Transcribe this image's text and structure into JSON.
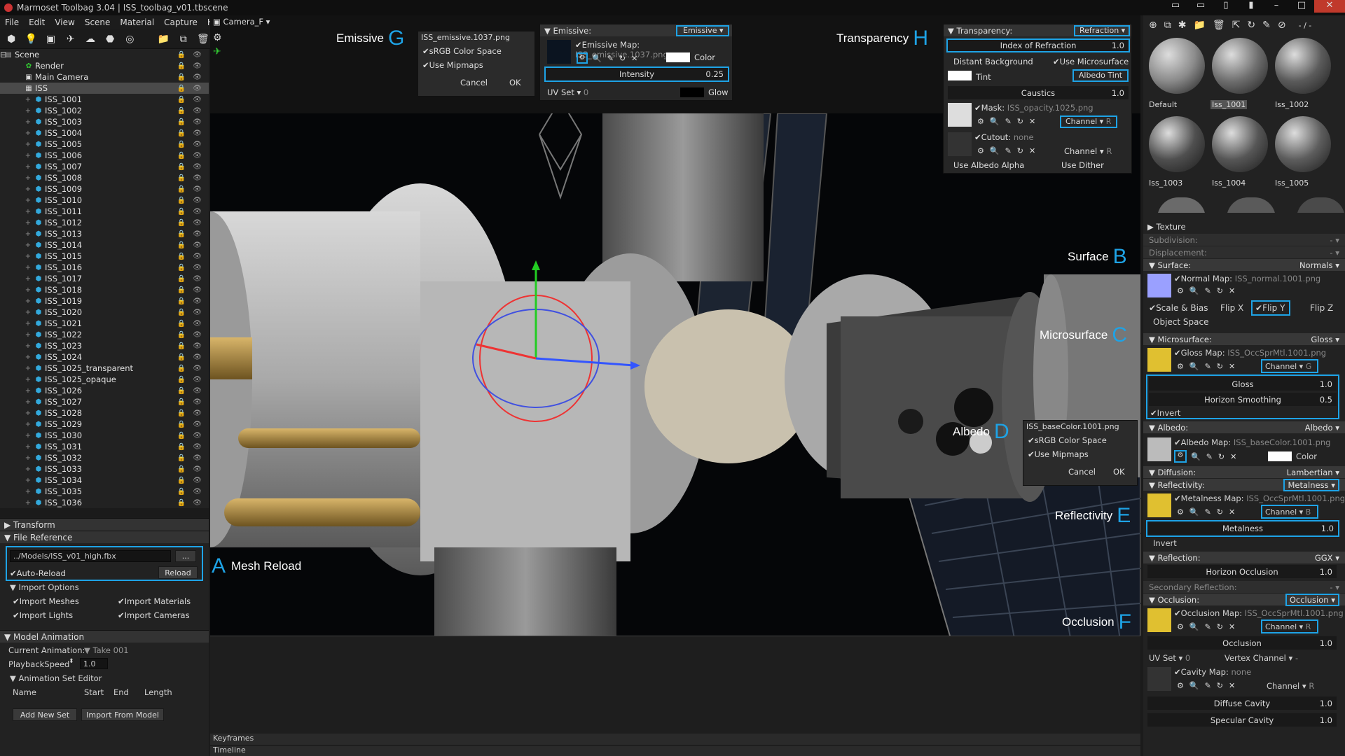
{
  "window": {
    "title": "Marmoset Toolbag 3.04  |  ISS_toolbag_v01.tbscene"
  },
  "menu": [
    "File",
    "Edit",
    "View",
    "Scene",
    "Material",
    "Capture",
    "Help"
  ],
  "viewport": {
    "camera": "Camera_F"
  },
  "outliner": {
    "items": [
      {
        "label": "Scene",
        "level": 0,
        "kind": "scene"
      },
      {
        "label": "Render",
        "level": 1,
        "kind": "render"
      },
      {
        "label": "Main Camera",
        "level": 1,
        "kind": "camera"
      },
      {
        "label": "ISS",
        "level": 1,
        "kind": "group",
        "selected": true
      },
      {
        "label": "ISS_1001",
        "level": 2,
        "kind": "mesh"
      },
      {
        "label": "ISS_1002",
        "level": 2,
        "kind": "mesh"
      },
      {
        "label": "ISS_1003",
        "level": 2,
        "kind": "mesh"
      },
      {
        "label": "ISS_1004",
        "level": 2,
        "kind": "mesh"
      },
      {
        "label": "ISS_1005",
        "level": 2,
        "kind": "mesh"
      },
      {
        "label": "ISS_1006",
        "level": 2,
        "kind": "mesh"
      },
      {
        "label": "ISS_1007",
        "level": 2,
        "kind": "mesh"
      },
      {
        "label": "ISS_1008",
        "level": 2,
        "kind": "mesh"
      },
      {
        "label": "ISS_1009",
        "level": 2,
        "kind": "mesh"
      },
      {
        "label": "ISS_1010",
        "level": 2,
        "kind": "mesh"
      },
      {
        "label": "ISS_1011",
        "level": 2,
        "kind": "mesh"
      },
      {
        "label": "ISS_1012",
        "level": 2,
        "kind": "mesh"
      },
      {
        "label": "ISS_1013",
        "level": 2,
        "kind": "mesh"
      },
      {
        "label": "ISS_1014",
        "level": 2,
        "kind": "mesh"
      },
      {
        "label": "ISS_1015",
        "level": 2,
        "kind": "mesh"
      },
      {
        "label": "ISS_1016",
        "level": 2,
        "kind": "mesh"
      },
      {
        "label": "ISS_1017",
        "level": 2,
        "kind": "mesh"
      },
      {
        "label": "ISS_1018",
        "level": 2,
        "kind": "mesh"
      },
      {
        "label": "ISS_1019",
        "level": 2,
        "kind": "mesh"
      },
      {
        "label": "ISS_1020",
        "level": 2,
        "kind": "mesh"
      },
      {
        "label": "ISS_1021",
        "level": 2,
        "kind": "mesh"
      },
      {
        "label": "ISS_1022",
        "level": 2,
        "kind": "mesh"
      },
      {
        "label": "ISS_1023",
        "level": 2,
        "kind": "mesh"
      },
      {
        "label": "ISS_1024",
        "level": 2,
        "kind": "mesh"
      },
      {
        "label": "ISS_1025_transparent",
        "level": 2,
        "kind": "mesh"
      },
      {
        "label": "ISS_1025_opaque",
        "level": 2,
        "kind": "mesh"
      },
      {
        "label": "ISS_1026",
        "level": 2,
        "kind": "mesh"
      },
      {
        "label": "ISS_1027",
        "level": 2,
        "kind": "mesh"
      },
      {
        "label": "ISS_1028",
        "level": 2,
        "kind": "mesh"
      },
      {
        "label": "ISS_1029",
        "level": 2,
        "kind": "mesh"
      },
      {
        "label": "ISS_1030",
        "level": 2,
        "kind": "mesh"
      },
      {
        "label": "ISS_1031",
        "level": 2,
        "kind": "mesh"
      },
      {
        "label": "ISS_1032",
        "level": 2,
        "kind": "mesh"
      },
      {
        "label": "ISS_1033",
        "level": 2,
        "kind": "mesh"
      },
      {
        "label": "ISS_1034",
        "level": 2,
        "kind": "mesh"
      },
      {
        "label": "ISS_1035",
        "level": 2,
        "kind": "mesh"
      },
      {
        "label": "ISS_1036",
        "level": 2,
        "kind": "mesh"
      }
    ]
  },
  "transform": {
    "title": "Transform"
  },
  "file_reference": {
    "title": "File Reference",
    "path": "../Models/ISS_v01_high.fbx",
    "browse": "...",
    "auto_reload": "Auto-Reload",
    "reload": "Reload",
    "import_options": "Import Options",
    "import_meshes": "Import Meshes",
    "import_materials": "Import Materials",
    "import_lights": "Import Lights",
    "import_cameras": "Import Cameras"
  },
  "model_animation": {
    "title": "Model Animation",
    "current_label": "Current Animation:",
    "current_value": "Take 001",
    "speed_label": "PlaybackSpeed",
    "speed_value": "1.0",
    "set_editor": "Animation Set Editor",
    "col_name": "Name",
    "col_start": "Start",
    "col_end": "End",
    "col_length": "Length",
    "add_set": "Add New Set",
    "import_model": "Import From Model"
  },
  "timeline": {
    "keyframes": "Keyframes",
    "timeline": "Timeline"
  },
  "callouts": {
    "emissive": "Emissive",
    "G": "G",
    "transparency": "Transparency",
    "H": "H",
    "surface": "Surface",
    "B": "B",
    "microsurface": "Microsurface",
    "C": "C",
    "albedo": "Albedo",
    "D": "D",
    "reflectivity": "Reflectivity",
    "E": "E",
    "occlusion": "Occlusion",
    "F": "F",
    "A": "A",
    "mesh_reload": "Mesh Reload"
  },
  "popup_g": {
    "file": "ISS_emissive.1037.png",
    "srgb": "sRGB Color Space",
    "mips": "Use Mipmaps",
    "cancel": "Cancel",
    "ok": "OK"
  },
  "popup_d": {
    "file": "ISS_baseColor.1001.png",
    "srgb": "sRGB Color Space",
    "mips": "Use Mipmaps",
    "cancel": "Cancel",
    "ok": "OK"
  },
  "emissive_panel": {
    "title": "Emissive:",
    "mode": "Emissive",
    "map_label": "Emissive Map:",
    "map_file": "ISS_emissive.1037.png",
    "color": "Color",
    "intensity_label": "Intensity",
    "intensity": "0.25",
    "uvset": "UV Set",
    "uvval": "0",
    "glow": "Glow"
  },
  "transparency_panel": {
    "title": "Transparency:",
    "mode": "Refraction",
    "ior_label": "Index of Refraction",
    "ior": "1.0",
    "distant": "Distant Background",
    "microsurface": "Use Microsurface",
    "tint": "Tint",
    "albedo_tint": "Albedo Tint",
    "caustics": "Caustics",
    "caustics_val": "1.0",
    "mask_label": "Mask:",
    "mask_file": "ISS_opacity.1025.png",
    "channel": "Channel",
    "channel_r": "R",
    "cutout_label": "Cutout:",
    "cutout_file": "none",
    "channel2": "Channel",
    "channel2_r": "R",
    "albedo_alpha": "Use Albedo Alpha",
    "dither": "Use Dither"
  },
  "right": {
    "materials": [
      {
        "label": "Default",
        "color": "#8a8a8a"
      },
      {
        "label": "Iss_1001",
        "color": "#6e6e6e",
        "selected": true
      },
      {
        "label": "Iss_1002",
        "color": "#5b5b5b"
      },
      {
        "label": "Iss_1003",
        "color": "#4f4f4f"
      },
      {
        "label": "Iss_1004",
        "color": "#565656"
      },
      {
        "label": "Iss_1005",
        "color": "#5d5d5d"
      }
    ],
    "zoom": "- / -",
    "texture": "Texture",
    "subdivision": "Subdivision:",
    "subdivision_v": "- ▾",
    "displacement": "Displacement:",
    "displacement_v": "- ▾",
    "surface": {
      "title": "Surface:",
      "mode": "Normals",
      "map_label": "Normal Map:",
      "map_file": "ISS_normal.1001.png",
      "scale_bias": "Scale & Bias",
      "flip_x": "Flip X",
      "flip_y": "Flip Y",
      "flip_z": "Flip Z",
      "object_space": "Object Space"
    },
    "microsurface": {
      "title": "Microsurface:",
      "mode": "Gloss",
      "map_label": "Gloss Map:",
      "map_file": "ISS_OccSprMtl.1001.png",
      "channel": "Channel",
      "ch": "G",
      "gloss_label": "Gloss",
      "gloss": "1.0",
      "horizon_label": "Horizon Smoothing",
      "horizon": "0.5",
      "invert": "Invert"
    },
    "albedo": {
      "title": "Albedo:",
      "mode": "Albedo",
      "map_label": "Albedo Map:",
      "map_file": "ISS_baseColor.1001.png",
      "color": "Color"
    },
    "diffusion": {
      "title": "Diffusion:",
      "mode": "Lambertian"
    },
    "reflectivity": {
      "title": "Reflectivity:",
      "mode": "Metalness",
      "map_label": "Metalness Map:",
      "map_file": "ISS_OccSprMtl.1001.png",
      "channel": "Channel",
      "ch": "B",
      "metal_label": "Metalness",
      "metal": "1.0",
      "invert": "Invert"
    },
    "reflection": {
      "title": "Reflection:",
      "mode": "GGX",
      "horizon_label": "Horizon Occlusion",
      "horizon": "1.0",
      "secondary": "Secondary Reflection:",
      "secondary_v": "- ▾"
    },
    "occlusion": {
      "title": "Occlusion:",
      "mode": "Occlusion",
      "map_label": "Occlusion Map:",
      "map_file": "ISS_OccSprMtl.1001.png",
      "channel": "Channel",
      "ch": "R",
      "occ_label": "Occlusion",
      "occ": "1.0",
      "uvset": "UV Set",
      "uvval": "0",
      "vertex": "Vertex Channel",
      "vertex_v": "-",
      "cavity_label": "Cavity Map:",
      "cavity_file": "none",
      "channel2": "Channel",
      "ch2": "R",
      "diffuse_label": "Diffuse Cavity",
      "diffuse": "1.0",
      "specular_label": "Specular Cavity",
      "specular": "1.0"
    }
  }
}
